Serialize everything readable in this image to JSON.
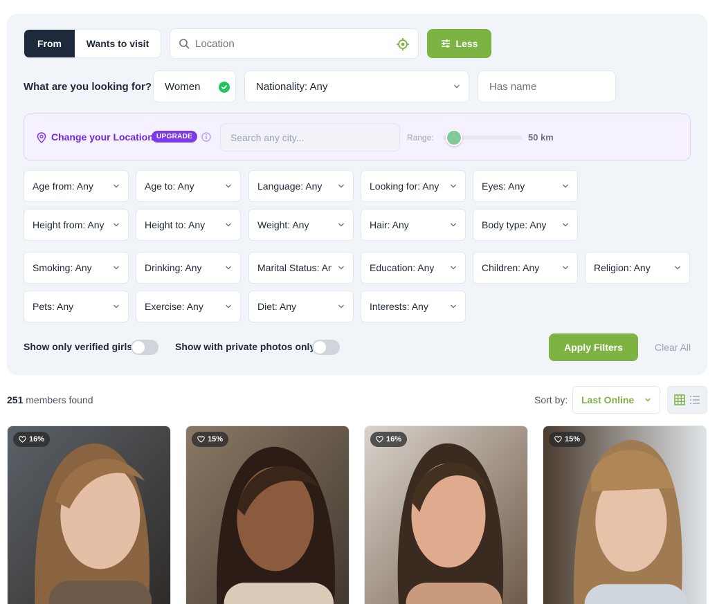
{
  "search": {
    "mode_from": "From",
    "mode_wants": "Wants to visit",
    "location_placeholder": "Location",
    "less_label": "Less"
  },
  "looking": {
    "question": "What are you looking for?",
    "gender": "Women",
    "nationality": "Nationality: Any",
    "has_name_placeholder": "Has name"
  },
  "location_band": {
    "change_label": "Change your Location",
    "upgrade_badge": "UPGRADE",
    "city_placeholder": "Search any city...",
    "range_label": "Range:",
    "range_value": "50 km",
    "range_fraction": 0.0
  },
  "filters": {
    "row1": [
      "Age from: Any",
      "Age to: Any",
      "Language: Any",
      "Looking for: Any",
      "Eyes: Any"
    ],
    "row2": [
      "Height from: Any",
      "Height to: Any",
      "Weight: Any",
      "Hair: Any",
      "Body type: Any"
    ],
    "row3": [
      "Smoking: Any",
      "Drinking: Any",
      "Marital Status: Any",
      "Education: Any",
      "Children: Any",
      "Religion: Any"
    ],
    "row4": [
      "Pets: Any",
      "Exercise: Any",
      "Diet: Any",
      "Interests: Any"
    ]
  },
  "switches": {
    "verified": "Show only verified girls",
    "private": "Show with private photos only"
  },
  "actions": {
    "apply": "Apply Filters",
    "clear": "Clear All"
  },
  "results": {
    "count": "251",
    "count_suffix": " members found",
    "sort_label": "Sort by:",
    "sort_value": "Last Online"
  },
  "cards": [
    {
      "match": "16%"
    },
    {
      "match": "15%"
    },
    {
      "match": "16%"
    },
    {
      "match": "15%"
    }
  ],
  "colors": {
    "accent_green": "#7cb342",
    "dark": "#1e293b",
    "purple": "#7c3aed"
  }
}
